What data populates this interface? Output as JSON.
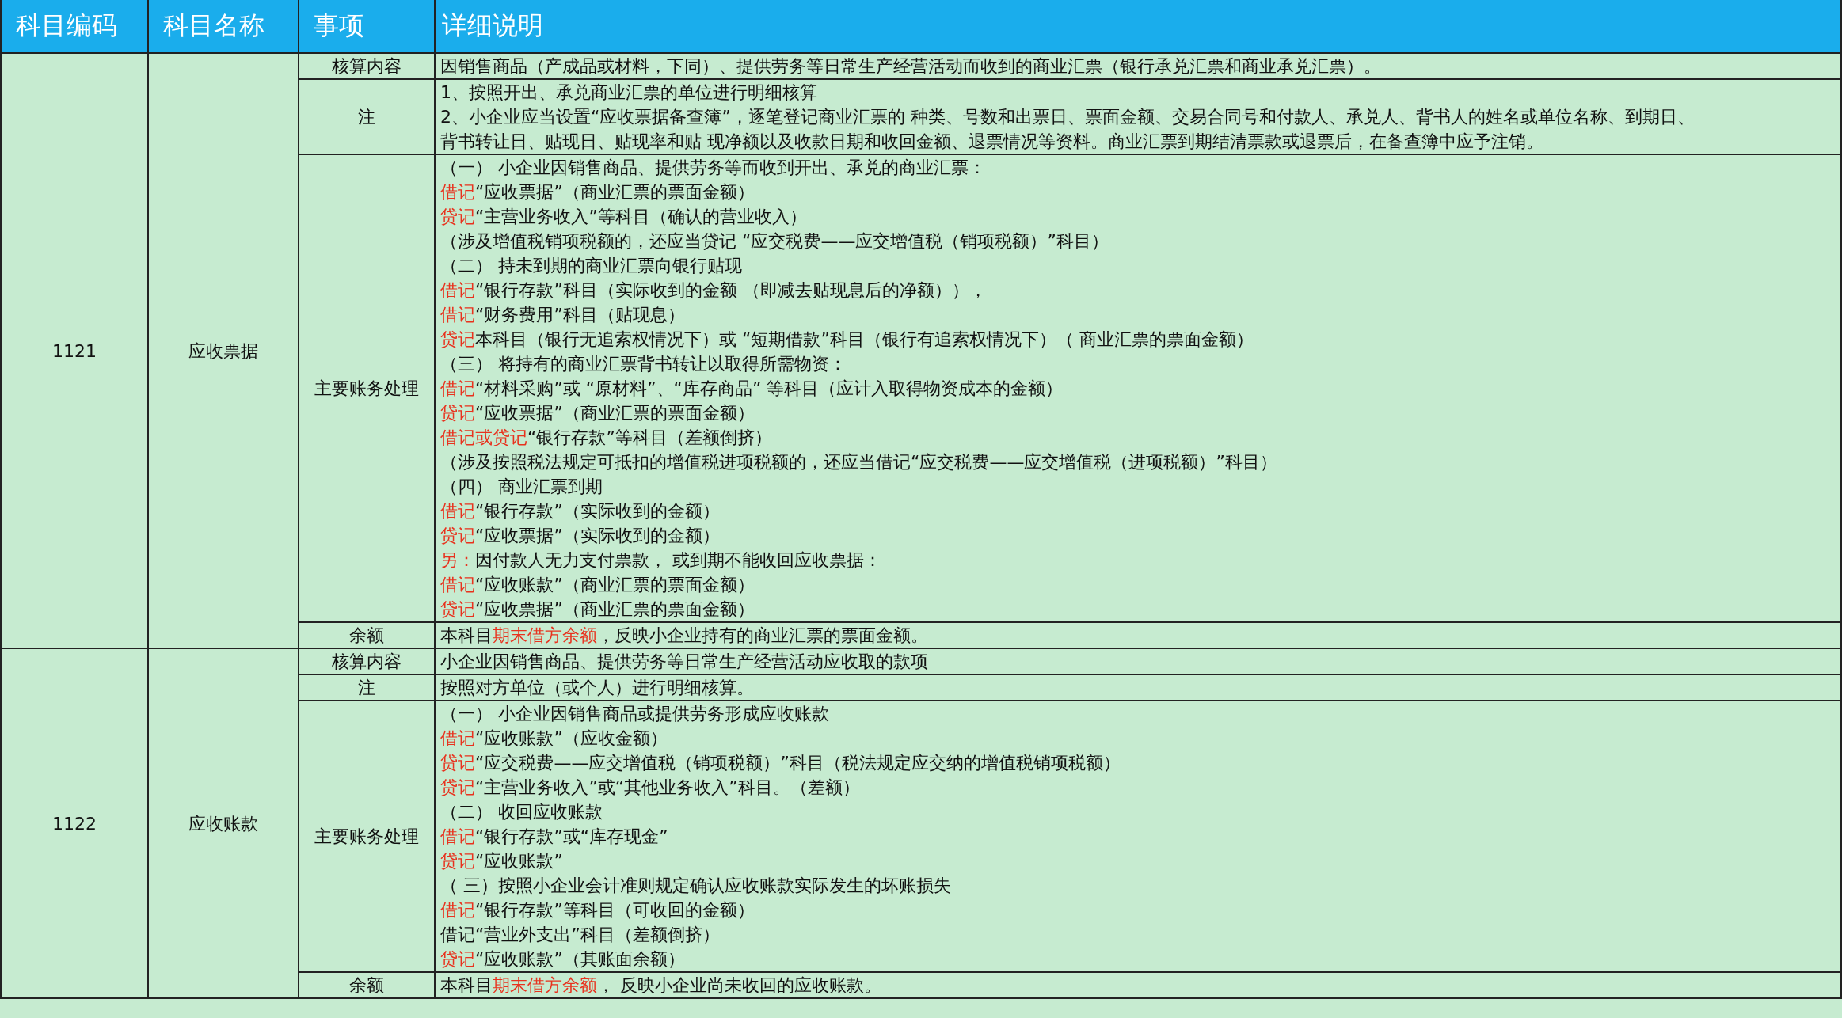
{
  "columns": [
    "科目编码",
    "科目名称",
    "事项",
    "详细说明"
  ],
  "accounts": [
    {
      "code": "1121",
      "name": "应收票据",
      "items": [
        {
          "label": "核算内容",
          "lines": [
            [
              {
                "text": "因销售商品（产成品或材料，下同）、提供劳务等日常生产经营活动而收到的商业汇票（银行承兑汇票和商业承兑汇票）。",
                "highlight": false
              }
            ]
          ]
        },
        {
          "label": "注",
          "lines": [
            [
              {
                "text": "1、按照开出、承兑商业汇票的单位进行明细核算",
                "highlight": false
              }
            ],
            [
              {
                "text": "2、小企业应当设置“应收票据备查簿”，逐笔登记商业汇票的 种类、号数和出票日、票面金额、交易合同号和付款人、承兑人、背书人的姓名或单位名称、到期日、",
                "highlight": false
              }
            ],
            [
              {
                "text": "背书转让日、贴现日、贴现率和贴 现净额以及收款日期和收回金额、退票情况等资料。商业汇票到期结清票款或退票后，在备查簿中应予注销。",
                "highlight": false
              }
            ]
          ]
        },
        {
          "label": "主要账务处理",
          "lines": [
            [
              {
                "text": "（一） 小企业因销售商品、提供劳务等而收到开出、承兑的商业汇票：",
                "highlight": false
              }
            ],
            [
              {
                "text": "借记",
                "highlight": true
              },
              {
                "text": "“应收票据”（商业汇票的票面金额）",
                "highlight": false
              }
            ],
            [
              {
                "text": "贷记",
                "highlight": true
              },
              {
                "text": "“主营业务收入”等科目（确认的营业收入）",
                "highlight": false
              }
            ],
            [
              {
                "text": "（涉及增值税销项税额的，还应当贷记 “应交税费——应交增值税（销项税额）”科目）",
                "highlight": false
              }
            ],
            [
              {
                "text": "（二） 持未到期的商业汇票向银行贴现",
                "highlight": false
              }
            ],
            [
              {
                "text": "借记",
                "highlight": true
              },
              {
                "text": "“银行存款”科目（实际收到的金额 （即减去贴现息后的净额）），",
                "highlight": false
              }
            ],
            [
              {
                "text": "借记",
                "highlight": true
              },
              {
                "text": "“财务费用”科目（贴现息）",
                "highlight": false
              }
            ],
            [
              {
                "text": "贷记",
                "highlight": true
              },
              {
                "text": "本科目（银行无追索权情况下）或 “短期借款”科目（银行有追索权情况下）（ 商业汇票的票面金额）",
                "highlight": false
              }
            ],
            [
              {
                "text": "（三） 将持有的商业汇票背书转让以取得所需物资：",
                "highlight": false
              }
            ],
            [
              {
                "text": "借记",
                "highlight": true
              },
              {
                "text": "“材料采购”或 “原材料”、“库存商品” 等科目（应计入取得物资成本的金额）",
                "highlight": false
              }
            ],
            [
              {
                "text": "贷记",
                "highlight": true
              },
              {
                "text": "“应收票据”（商业汇票的票面金额）",
                "highlight": false
              }
            ],
            [
              {
                "text": "借记或贷记",
                "highlight": true
              },
              {
                "text": "“银行存款”等科目（差额倒挤）",
                "highlight": false
              }
            ],
            [
              {
                "text": "（涉及按照税法规定可抵扣的增值税进项税额的，还应当借记“应交税费——应交增值税（进项税额）”科目）",
                "highlight": false
              }
            ],
            [
              {
                "text": "（四） 商业汇票到期",
                "highlight": false
              }
            ],
            [
              {
                "text": "借记",
                "highlight": true
              },
              {
                "text": "“银行存款”（实际收到的金额）",
                "highlight": false
              }
            ],
            [
              {
                "text": "贷记",
                "highlight": true
              },
              {
                "text": "“应收票据”（实际收到的金额）",
                "highlight": false
              }
            ],
            [
              {
                "text": "另：",
                "highlight": true
              },
              {
                "text": "因付款人无力支付票款， 或到期不能收回应收票据：",
                "highlight": false
              }
            ],
            [
              {
                "text": "借记",
                "highlight": true
              },
              {
                "text": "“应收账款”（商业汇票的票面金额）",
                "highlight": false
              }
            ],
            [
              {
                "text": "贷记",
                "highlight": true
              },
              {
                "text": "“应收票据”（商业汇票的票面金额）",
                "highlight": false
              }
            ]
          ]
        },
        {
          "label": "余额",
          "lines": [
            [
              {
                "text": "本科目",
                "highlight": false
              },
              {
                "text": "期末借方余额",
                "highlight": true
              },
              {
                "text": "，反映小企业持有的商业汇票的票面金额。",
                "highlight": false
              }
            ]
          ]
        }
      ]
    },
    {
      "code": "1122",
      "name": "应收账款",
      "items": [
        {
          "label": "核算内容",
          "lines": [
            [
              {
                "text": "小企业因销售商品、提供劳务等日常生产经营活动应收取的款项",
                "highlight": false
              }
            ]
          ]
        },
        {
          "label": "注",
          "lines": [
            [
              {
                "text": "按照对方单位（或个人）进行明细核算。",
                "highlight": false
              }
            ]
          ]
        },
        {
          "label": "主要账务处理",
          "lines": [
            [
              {
                "text": "（一） 小企业因销售商品或提供劳务形成应收账款",
                "highlight": false
              }
            ],
            [
              {
                "text": "借记",
                "highlight": true
              },
              {
                "text": "“应收账款”（应收金额）",
                "highlight": false
              }
            ],
            [
              {
                "text": "贷记",
                "highlight": true
              },
              {
                "text": "“应交税费——应交增值税（销项税额）”科目（税法规定应交纳的增值税销项税额）",
                "highlight": false
              }
            ],
            [
              {
                "text": "贷记",
                "highlight": true
              },
              {
                "text": "“主营业务收入”或“其他业务收入”科目。（差额）",
                "highlight": false
              }
            ],
            [
              {
                "text": "（二） 收回应收账款",
                "highlight": false
              }
            ],
            [
              {
                "text": "借记",
                "highlight": true
              },
              {
                "text": "“银行存款”或“库存现金”",
                "highlight": false
              }
            ],
            [
              {
                "text": "贷记",
                "highlight": true
              },
              {
                "text": "“应收账款”",
                "highlight": false
              }
            ],
            [
              {
                "text": "（ 三）按照小企业会计准则规定确认应收账款实际发生的坏账损失",
                "highlight": false
              }
            ],
            [
              {
                "text": "借记",
                "highlight": true
              },
              {
                "text": "“银行存款”等科目（可收回的金额）",
                "highlight": false
              }
            ],
            [
              {
                "text": "借记“营业外支出”科目（差额倒挤）",
                "highlight": false
              }
            ],
            [
              {
                "text": "贷记",
                "highlight": true
              },
              {
                "text": "“应收账款”（其账面余额）",
                "highlight": false
              }
            ]
          ]
        },
        {
          "label": "余额",
          "lines": [
            [
              {
                "text": "本科目",
                "highlight": false
              },
              {
                "text": "期末借方余额",
                "highlight": true
              },
              {
                "text": "， 反映小企业尚未收回的应收账款。",
                "highlight": false
              }
            ]
          ]
        }
      ]
    }
  ]
}
